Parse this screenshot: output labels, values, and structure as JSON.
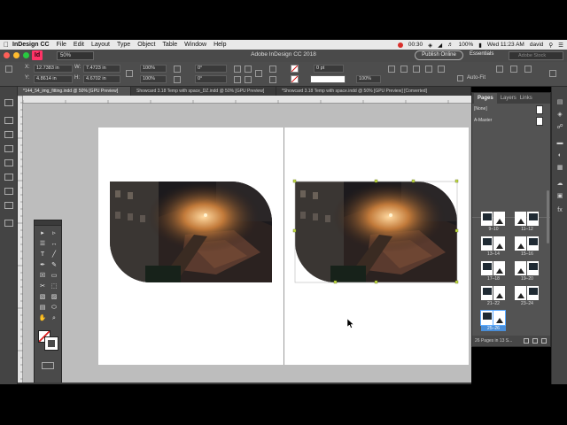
{
  "menubar": {
    "apple": "",
    "app_name": "InDesign CC",
    "items": [
      "File",
      "Edit",
      "Layout",
      "Type",
      "Object",
      "Table",
      "Window",
      "Help"
    ],
    "timer": "00:30",
    "battery": "100%",
    "clock": "Wed 11:23 AM",
    "user": "david"
  },
  "window": {
    "title": "Adobe InDesign CC 2018",
    "app_logo": "Id",
    "zoom": "50%",
    "publish_label": "Publish Online",
    "workspace": "Essentials",
    "stock_placeholder": "Adobe Stock"
  },
  "control_panel": {
    "x_label": "X:",
    "x_value": "12.7383 in",
    "y_label": "Y:",
    "y_value": "4.8614 in",
    "w_label": "W:",
    "w_value": "7.4723 in",
    "h_label": "H:",
    "h_value": "4.6702 in",
    "scale_x": "100%",
    "scale_y": "100%",
    "rotate": "0°",
    "shear": "0°",
    "stroke": "0 pt",
    "opacity": "100%",
    "auto_fit": "Auto-Fit"
  },
  "tabs": [
    {
      "label": "*144_54_img_fitting.indd @ 50% [GPU Preview]",
      "active": true
    },
    {
      "label": "Showcard 3.18 Temp with space_DZ.indd @ 50% [GPU Preview]",
      "active": false
    },
    {
      "label": "*Showcard 3.18 Temp with space.indd @ 50% [GPU Preview] [Converted]",
      "active": false
    }
  ],
  "pages_panel": {
    "tabs": [
      "Pages",
      "Layers",
      "Links"
    ],
    "masters": [
      "[None]",
      "A-Master"
    ],
    "spreads": [
      "9–10",
      "11–12",
      "13–14",
      "15–16",
      "17–18",
      "19–20",
      "21–22",
      "23–24",
      "25–26"
    ],
    "selected_spread": "25–26",
    "footer": "26 Pages in 13 S..."
  },
  "colors": {
    "accent": "#4a8ed8",
    "canvas": "#bdbdbd",
    "selection": "#5aa9ff",
    "frame_handle": "#c6e04a"
  },
  "icons": {
    "tools": [
      "selection-tool-icon",
      "direct-selection-tool-icon",
      "page-tool-icon",
      "gap-tool-icon",
      "type-tool-icon",
      "line-tool-icon",
      "pen-tool-icon",
      "pencil-tool-icon",
      "rectangle-frame-tool-icon",
      "rectangle-tool-icon",
      "scissors-tool-icon",
      "free-transform-tool-icon",
      "gradient-tool-icon",
      "gradient-feather-tool-icon",
      "note-tool-icon",
      "eyedropper-tool-icon",
      "hand-tool-icon",
      "zoom-tool-icon",
      "fill-stroke-icon",
      "view-mode-icon"
    ]
  }
}
